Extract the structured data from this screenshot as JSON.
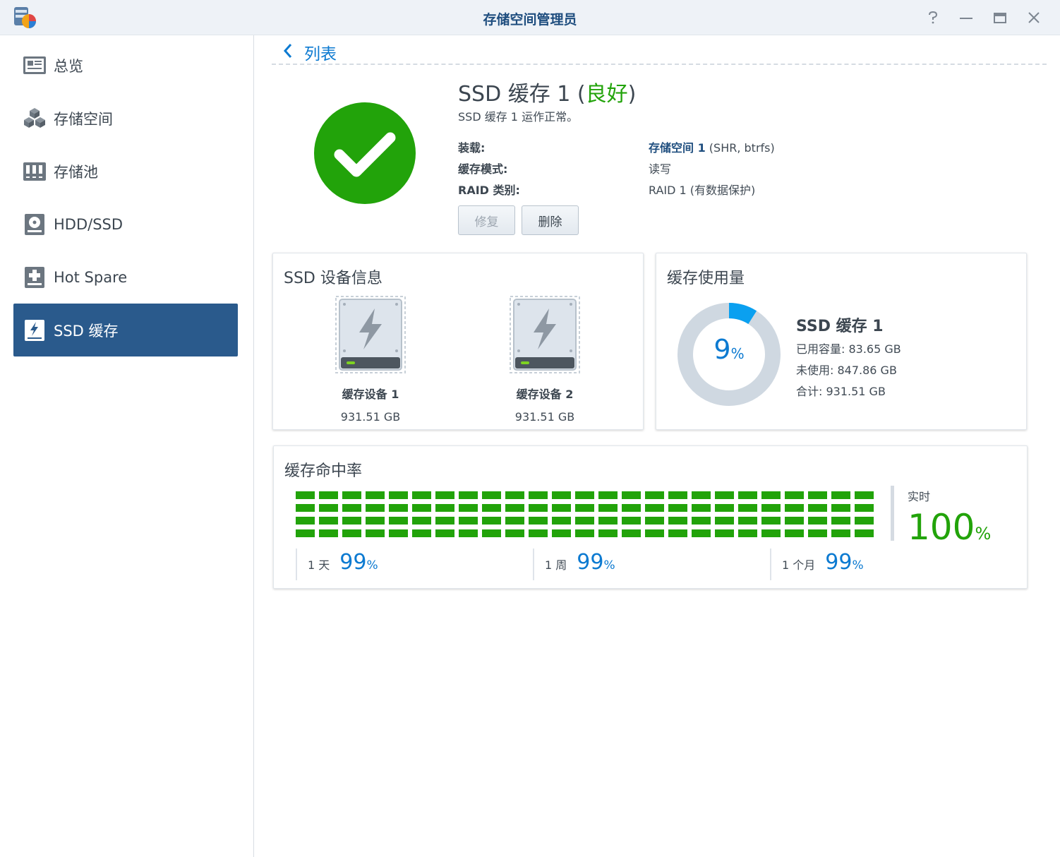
{
  "window": {
    "title": "存储空间管理员",
    "controls": [
      "help-icon",
      "minimize-icon",
      "maximize-icon",
      "close-icon"
    ]
  },
  "sidebar": {
    "items": [
      {
        "label": "总览",
        "icon": "overview-icon"
      },
      {
        "label": "存储空间",
        "icon": "volume-icon"
      },
      {
        "label": "存储池",
        "icon": "storage-pool-icon"
      },
      {
        "label": "HDD/SSD",
        "icon": "disk-icon"
      },
      {
        "label": "Hot Spare",
        "icon": "hot-spare-icon"
      },
      {
        "label": "SSD 缓存",
        "icon": "ssd-cache-icon",
        "active": true
      }
    ]
  },
  "header": {
    "back_label": "列表"
  },
  "summary": {
    "title_prefix": "SSD 缓存 1 (",
    "status": "良好",
    "title_suffix": ")",
    "subtitle": "SSD 缓存 1 运作正常。",
    "rows": [
      {
        "label": "装载:",
        "value_link": "存储空间 1",
        "value": " (SHR, btrfs)"
      },
      {
        "label": "缓存模式:",
        "value": "读写"
      },
      {
        "label": "RAID 类别:",
        "value": "RAID 1 (有数据保护)"
      }
    ],
    "buttons": {
      "repair": "修复",
      "delete": "删除"
    }
  },
  "devices": {
    "title": "SSD 设备信息",
    "items": [
      {
        "name": "缓存设备 1",
        "size": "931.51 GB"
      },
      {
        "name": "缓存设备 2",
        "size": "931.51 GB"
      }
    ]
  },
  "usage": {
    "title": "缓存使用量",
    "percent": "9",
    "percent_sign": "%",
    "name": "SSD 缓存 1",
    "used": "已用容量: 83.65 GB",
    "free": "未使用: 847.86 GB",
    "total": "合计: 931.51 GB",
    "colors": {
      "used": "#0aa0f0",
      "free": "#cfd8e1"
    }
  },
  "hitrate": {
    "title": "缓存命中率",
    "grid_rows": 4,
    "grid_cols": 25,
    "grid_color": "#22a30a",
    "periods": [
      {
        "label": "1 天",
        "value": "99",
        "unit": "%"
      },
      {
        "label": "1 周",
        "value": "99",
        "unit": "%"
      },
      {
        "label": "1 个月",
        "value": "99",
        "unit": "%"
      }
    ],
    "realtime_label": "实时",
    "realtime_value": "100",
    "realtime_unit": "%"
  }
}
